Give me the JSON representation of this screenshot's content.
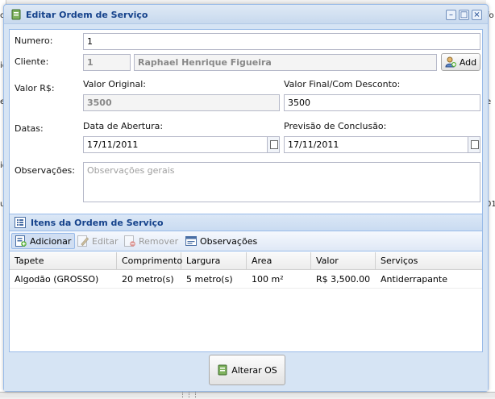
{
  "background": {
    "left_fragments": [
      "c",
      "ic",
      "e",
      "ic",
      "u"
    ],
    "right_fragments": [
      "fo",
      "e",
      "01"
    ]
  },
  "window": {
    "title": "Editar Ordem de Serviço",
    "tools": [
      "minimize-icon",
      "maximize-icon",
      "close-icon"
    ]
  },
  "form": {
    "numero": {
      "label": "Numero:",
      "value": "1"
    },
    "cliente": {
      "label": "Cliente:",
      "id": "1",
      "name": "Raphael Henrique Figueira",
      "add_label": "Add"
    },
    "valor": {
      "label": "Valor R$:",
      "original_label": "Valor Original:",
      "original_value": "3500",
      "final_label": "Valor Final/Com Desconto:",
      "final_value": "3500"
    },
    "datas": {
      "label": "Datas:",
      "abertura_label": "Data de Abertura:",
      "abertura_value": "17/11/2011",
      "previsao_label": "Previsão de Conclusão:",
      "previsao_value": "17/11/2011"
    },
    "observacoes": {
      "label": "Observações:",
      "placeholder": "Observações gerais"
    }
  },
  "itens": {
    "title": "Itens da Ordem de Serviço",
    "toolbar": {
      "adicionar": "Adicionar",
      "editar": "Editar",
      "remover": "Remover",
      "observacoes": "Observações"
    },
    "columns": [
      "Tapete",
      "Comprimento",
      "Largura",
      "Area",
      "Valor",
      "Serviços"
    ],
    "rows": [
      [
        "Algodão (GROSSO)",
        "20 metro(s)",
        "5 metro(s)",
        "100 m²",
        "R$ 3,500.00",
        "Antiderrapante"
      ]
    ]
  },
  "footer": {
    "submit_label": "Alterar OS"
  },
  "colors": {
    "header_text": "#15428b",
    "border": "#99bbe8",
    "panel_bg": "#d6e4f4"
  }
}
